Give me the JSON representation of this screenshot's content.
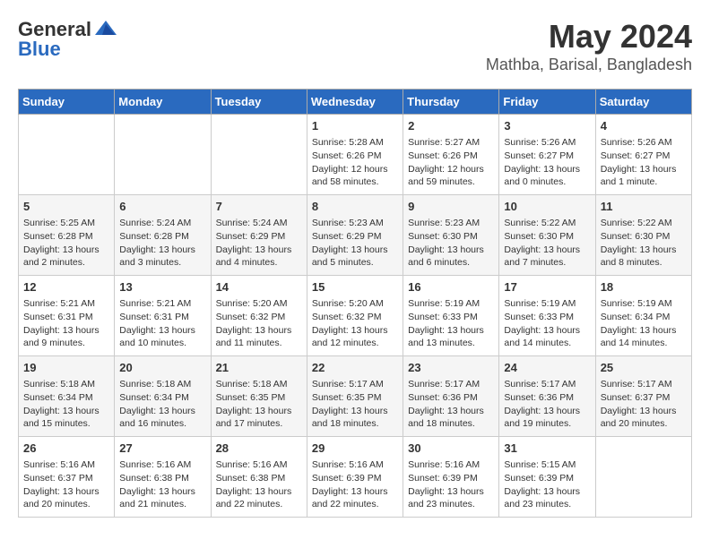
{
  "logo": {
    "general": "General",
    "blue": "Blue"
  },
  "title": {
    "month": "May 2024",
    "location": "Mathba, Barisal, Bangladesh"
  },
  "weekdays": [
    "Sunday",
    "Monday",
    "Tuesday",
    "Wednesday",
    "Thursday",
    "Friday",
    "Saturday"
  ],
  "weeks": [
    [
      {
        "day": "",
        "info": ""
      },
      {
        "day": "",
        "info": ""
      },
      {
        "day": "",
        "info": ""
      },
      {
        "day": "1",
        "info": "Sunrise: 5:28 AM\nSunset: 6:26 PM\nDaylight: 12 hours\nand 58 minutes."
      },
      {
        "day": "2",
        "info": "Sunrise: 5:27 AM\nSunset: 6:26 PM\nDaylight: 12 hours\nand 59 minutes."
      },
      {
        "day": "3",
        "info": "Sunrise: 5:26 AM\nSunset: 6:27 PM\nDaylight: 13 hours\nand 0 minutes."
      },
      {
        "day": "4",
        "info": "Sunrise: 5:26 AM\nSunset: 6:27 PM\nDaylight: 13 hours\nand 1 minute."
      }
    ],
    [
      {
        "day": "5",
        "info": "Sunrise: 5:25 AM\nSunset: 6:28 PM\nDaylight: 13 hours\nand 2 minutes."
      },
      {
        "day": "6",
        "info": "Sunrise: 5:24 AM\nSunset: 6:28 PM\nDaylight: 13 hours\nand 3 minutes."
      },
      {
        "day": "7",
        "info": "Sunrise: 5:24 AM\nSunset: 6:29 PM\nDaylight: 13 hours\nand 4 minutes."
      },
      {
        "day": "8",
        "info": "Sunrise: 5:23 AM\nSunset: 6:29 PM\nDaylight: 13 hours\nand 5 minutes."
      },
      {
        "day": "9",
        "info": "Sunrise: 5:23 AM\nSunset: 6:30 PM\nDaylight: 13 hours\nand 6 minutes."
      },
      {
        "day": "10",
        "info": "Sunrise: 5:22 AM\nSunset: 6:30 PM\nDaylight: 13 hours\nand 7 minutes."
      },
      {
        "day": "11",
        "info": "Sunrise: 5:22 AM\nSunset: 6:30 PM\nDaylight: 13 hours\nand 8 minutes."
      }
    ],
    [
      {
        "day": "12",
        "info": "Sunrise: 5:21 AM\nSunset: 6:31 PM\nDaylight: 13 hours\nand 9 minutes."
      },
      {
        "day": "13",
        "info": "Sunrise: 5:21 AM\nSunset: 6:31 PM\nDaylight: 13 hours\nand 10 minutes."
      },
      {
        "day": "14",
        "info": "Sunrise: 5:20 AM\nSunset: 6:32 PM\nDaylight: 13 hours\nand 11 minutes."
      },
      {
        "day": "15",
        "info": "Sunrise: 5:20 AM\nSunset: 6:32 PM\nDaylight: 13 hours\nand 12 minutes."
      },
      {
        "day": "16",
        "info": "Sunrise: 5:19 AM\nSunset: 6:33 PM\nDaylight: 13 hours\nand 13 minutes."
      },
      {
        "day": "17",
        "info": "Sunrise: 5:19 AM\nSunset: 6:33 PM\nDaylight: 13 hours\nand 14 minutes."
      },
      {
        "day": "18",
        "info": "Sunrise: 5:19 AM\nSunset: 6:34 PM\nDaylight: 13 hours\nand 14 minutes."
      }
    ],
    [
      {
        "day": "19",
        "info": "Sunrise: 5:18 AM\nSunset: 6:34 PM\nDaylight: 13 hours\nand 15 minutes."
      },
      {
        "day": "20",
        "info": "Sunrise: 5:18 AM\nSunset: 6:34 PM\nDaylight: 13 hours\nand 16 minutes."
      },
      {
        "day": "21",
        "info": "Sunrise: 5:18 AM\nSunset: 6:35 PM\nDaylight: 13 hours\nand 17 minutes."
      },
      {
        "day": "22",
        "info": "Sunrise: 5:17 AM\nSunset: 6:35 PM\nDaylight: 13 hours\nand 18 minutes."
      },
      {
        "day": "23",
        "info": "Sunrise: 5:17 AM\nSunset: 6:36 PM\nDaylight: 13 hours\nand 18 minutes."
      },
      {
        "day": "24",
        "info": "Sunrise: 5:17 AM\nSunset: 6:36 PM\nDaylight: 13 hours\nand 19 minutes."
      },
      {
        "day": "25",
        "info": "Sunrise: 5:17 AM\nSunset: 6:37 PM\nDaylight: 13 hours\nand 20 minutes."
      }
    ],
    [
      {
        "day": "26",
        "info": "Sunrise: 5:16 AM\nSunset: 6:37 PM\nDaylight: 13 hours\nand 20 minutes."
      },
      {
        "day": "27",
        "info": "Sunrise: 5:16 AM\nSunset: 6:38 PM\nDaylight: 13 hours\nand 21 minutes."
      },
      {
        "day": "28",
        "info": "Sunrise: 5:16 AM\nSunset: 6:38 PM\nDaylight: 13 hours\nand 22 minutes."
      },
      {
        "day": "29",
        "info": "Sunrise: 5:16 AM\nSunset: 6:39 PM\nDaylight: 13 hours\nand 22 minutes."
      },
      {
        "day": "30",
        "info": "Sunrise: 5:16 AM\nSunset: 6:39 PM\nDaylight: 13 hours\nand 23 minutes."
      },
      {
        "day": "31",
        "info": "Sunrise: 5:15 AM\nSunset: 6:39 PM\nDaylight: 13 hours\nand 23 minutes."
      },
      {
        "day": "",
        "info": ""
      }
    ]
  ]
}
